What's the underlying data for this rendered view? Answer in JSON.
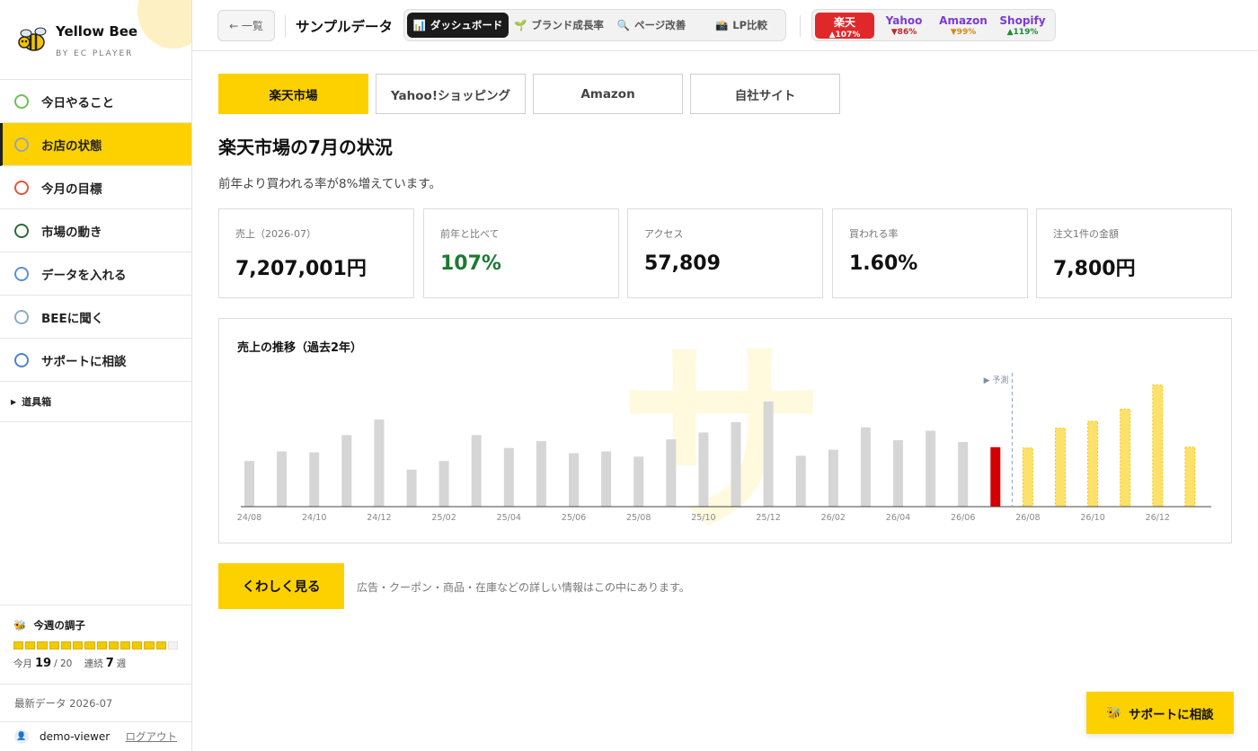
{
  "app": {
    "title": "Yellow Bee",
    "subtitle": "BY EC PLAYER"
  },
  "sidebar": {
    "items": [
      {
        "label": "今日やること",
        "icon": "check-circle-icon",
        "color": "#6dbf5a"
      },
      {
        "label": "お店の状態",
        "icon": "store-icon",
        "color": "#9aa4b2",
        "active": true
      },
      {
        "label": "今月の目標",
        "icon": "target-icon",
        "color": "#e0563a"
      },
      {
        "label": "市場の動き",
        "icon": "trend-icon",
        "color": "#2f6b3a"
      },
      {
        "label": "データを入れる",
        "icon": "upload-icon",
        "color": "#5a8fd8"
      },
      {
        "label": "BEEに聞く",
        "icon": "chat-icon",
        "color": "#8fa9c7"
      },
      {
        "label": "サポートに相談",
        "icon": "headset-icon",
        "color": "#4f83c9"
      }
    ],
    "toolbox": "道具箱",
    "week": {
      "title": "今週の調子",
      "month_label": "今月",
      "month_value": "19",
      "month_total": "/ 20",
      "streak_label": "連続",
      "streak_value": "7",
      "streak_unit": "週"
    },
    "latest_data": "最新データ 2026-07",
    "user": "demo-viewer",
    "logout": "ログアウト"
  },
  "topbar": {
    "back": "← 一覧",
    "page_name": "サンプルデータ",
    "tabs": [
      {
        "icon": "📊",
        "label": "ダッシュボード",
        "active": true
      },
      {
        "icon": "🌱",
        "label": "ブランド成長率"
      },
      {
        "icon": "🔍",
        "label": "ページ改善"
      },
      {
        "icon": "📸",
        "label": "LP比較"
      }
    ],
    "markets": [
      {
        "name": "楽天",
        "delta": "▲107%",
        "active": true,
        "color": "#ffffff"
      },
      {
        "name": "Yahoo",
        "delta": "▼86%",
        "color": "#c0282a"
      },
      {
        "name": "Amazon",
        "delta": "▼99%",
        "color": "#d4891a"
      },
      {
        "name": "Shopify",
        "delta": "▲119%",
        "color": "#1c8a33"
      }
    ]
  },
  "shop_tabs": [
    "楽天市場",
    "Yahoo!ショッピング",
    "Amazon",
    "自社サイト"
  ],
  "heading": "楽天市場の7月の状況",
  "subtext": "前年より買われる率が8%増えています。",
  "kpis": [
    {
      "label": "売上（2026-07）",
      "value": "7,207,001円"
    },
    {
      "label": "前年と比べて",
      "value": "107%"
    },
    {
      "label": "アクセス",
      "value": "57,809"
    },
    {
      "label": "買われる率",
      "value": "1.60%"
    },
    {
      "label": "注文1件の金額",
      "value": "7,800円"
    }
  ],
  "chart_data": {
    "type": "bar",
    "title": "売上の推移（過去2年）",
    "forecast_label": "▶ 予測",
    "categories": [
      "24/08",
      "24/09",
      "24/10",
      "24/11",
      "24/12",
      "25/01",
      "25/02",
      "25/03",
      "25/04",
      "25/05",
      "25/06",
      "25/07",
      "25/08",
      "25/09",
      "25/10",
      "25/11",
      "25/12",
      "26/01",
      "26/02",
      "26/03",
      "26/04",
      "26/05",
      "26/06",
      "26/07",
      "26/08",
      "26/09",
      "26/10",
      "26/11",
      "26/12",
      "27/01"
    ],
    "tick_labels": [
      "24/08",
      "24/10",
      "24/12",
      "25/02",
      "25/04",
      "25/06",
      "25/08",
      "25/10",
      "25/12",
      "26/02",
      "26/04",
      "26/06",
      "26/08",
      "26/10",
      "26/12"
    ],
    "series": [
      {
        "values": [
          5.3,
          6.4,
          6.3,
          8.3,
          10.1,
          4.3,
          5.3,
          8.3,
          6.8,
          7.6,
          6.2,
          6.4,
          5.8,
          7.8,
          8.6,
          9.8,
          12.2,
          5.9,
          6.6,
          9.2,
          7.7,
          8.8,
          7.5,
          6.9,
          0,
          0,
          0,
          0,
          0,
          0
        ]
      },
      {
        "values": [
          0,
          0,
          0,
          0,
          0,
          0,
          0,
          0,
          0,
          0,
          0,
          0,
          0,
          0,
          0,
          0,
          0,
          0,
          0,
          0,
          0,
          0,
          0,
          0,
          6.8,
          9.1,
          9.9,
          11.3,
          14.1,
          6.9
        ]
      }
    ],
    "colors": {
      "actual": "#d6d6d6",
      "current": "#d40000",
      "forecast": "#fde16a"
    },
    "ylim": [
      0,
      15
    ]
  },
  "more_button": "くわしく見る",
  "more_note": "広告・クーポン・商品・在庫などの詳しい情報はこの中にあります。",
  "support_button": "サポートに相談"
}
